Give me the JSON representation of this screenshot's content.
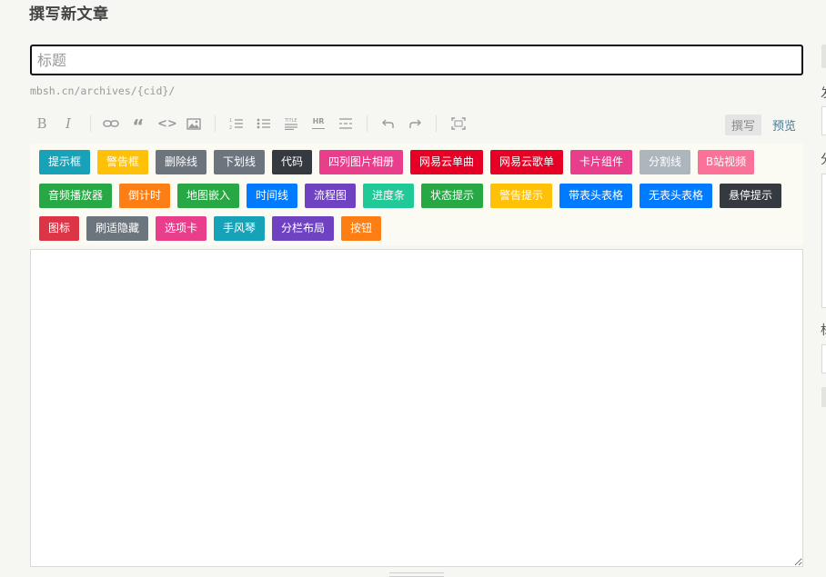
{
  "page": {
    "title": "撰写新文章"
  },
  "title_field": {
    "placeholder": "标题",
    "value": ""
  },
  "slug": {
    "prefix": "mbsh.cn/archives/",
    "slug": "{cid}",
    "suffix": "/"
  },
  "toolbar": {
    "buttons": [
      {
        "name": "bold-icon",
        "label": "B"
      },
      {
        "name": "italic-icon",
        "label": "I"
      },
      {
        "name": "link-icon"
      },
      {
        "name": "quote-icon",
        "label": "“"
      },
      {
        "name": "code-icon",
        "label": "<>"
      },
      {
        "name": "image-icon"
      },
      {
        "name": "ordered-list-icon"
      },
      {
        "name": "unordered-list-icon"
      },
      {
        "name": "heading-icon"
      },
      {
        "name": "hr-icon",
        "label": "HR"
      },
      {
        "name": "more-icon"
      },
      {
        "name": "undo-icon"
      },
      {
        "name": "redo-icon"
      },
      {
        "name": "fullscreen-icon"
      }
    ],
    "write_label": "撰写",
    "preview_label": "预览"
  },
  "shortcuts": [
    {
      "label": "提示框",
      "color": "#17a2b8"
    },
    {
      "label": "警告框",
      "color": "#ffc107"
    },
    {
      "label": "删除线",
      "color": "#6c757d"
    },
    {
      "label": "下划线",
      "color": "#6c757d"
    },
    {
      "label": "代码",
      "color": "#343a40"
    },
    {
      "label": "四列图片相册",
      "color": "#e83e8c"
    },
    {
      "label": "网易云单曲",
      "color": "#e60026"
    },
    {
      "label": "网易云歌单",
      "color": "#e60026"
    },
    {
      "label": "卡片组件",
      "color": "#e83e8c"
    },
    {
      "label": "分割线",
      "color": "#adb5bd"
    },
    {
      "label": "B站视频",
      "color": "#fb7299"
    },
    {
      "label": "音频播放器",
      "color": "#28a745"
    },
    {
      "label": "倒计时",
      "color": "#fd7e14"
    },
    {
      "label": "地图嵌入",
      "color": "#28a745"
    },
    {
      "label": "时间线",
      "color": "#007bff"
    },
    {
      "label": "流程图",
      "color": "#6f42c1"
    },
    {
      "label": "进度条",
      "color": "#20c997"
    },
    {
      "label": "状态提示",
      "color": "#28a745"
    },
    {
      "label": "警告提示",
      "color": "#ffc107"
    },
    {
      "label": "带表头表格",
      "color": "#007bff"
    },
    {
      "label": "无表头表格",
      "color": "#007bff"
    },
    {
      "label": "悬停提示",
      "color": "#343a40"
    },
    {
      "label": "图标",
      "color": "#dc3545"
    },
    {
      "label": "刷适隐藏",
      "color": "#6c757d"
    },
    {
      "label": "选项卡",
      "color": "#e83e8c"
    },
    {
      "label": "手风琴",
      "color": "#17a2b8"
    },
    {
      "label": "分栏布局",
      "color": "#6f42c1"
    },
    {
      "label": "按钮",
      "color": "#fd7e14"
    }
  ],
  "editor": {
    "value": ""
  },
  "sidebar": {
    "label_1": "发",
    "label_2": "分",
    "label_3": "标"
  }
}
